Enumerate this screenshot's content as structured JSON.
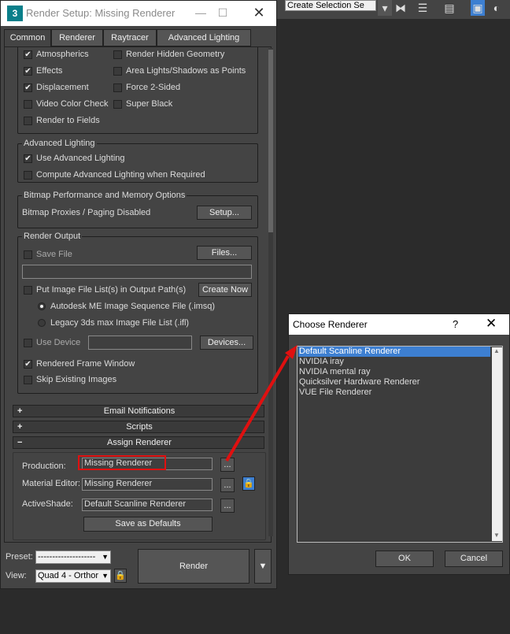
{
  "toolbar": {
    "selection_set_placeholder": "Create Selection Se"
  },
  "render_setup": {
    "title": "Render Setup: Missing Renderer",
    "tabs": [
      {
        "label": "Common",
        "active": true
      },
      {
        "label": "Renderer"
      },
      {
        "label": "Raytracer"
      },
      {
        "label": "Advanced Lighting"
      }
    ],
    "options": {
      "left": [
        {
          "label": "Atmospherics",
          "checked": true
        },
        {
          "label": "Effects",
          "checked": true
        },
        {
          "label": "Displacement",
          "checked": true
        },
        {
          "label": "Video Color Check",
          "checked": false
        },
        {
          "label": "Render to Fields",
          "checked": false
        }
      ],
      "right": [
        {
          "label": "Render Hidden Geometry",
          "checked": false
        },
        {
          "label": "Area Lights/Shadows as Points",
          "checked": false
        },
        {
          "label": "Force 2-Sided",
          "checked": false
        },
        {
          "label": "Super Black",
          "checked": false
        }
      ]
    },
    "advanced_lighting": {
      "title": "Advanced Lighting",
      "use_label": "Use Advanced Lighting",
      "compute_label": "Compute Advanced Lighting when Required"
    },
    "bitmap": {
      "title": "Bitmap Performance and Memory Options",
      "status": "Bitmap Proxies / Paging Disabled",
      "setup_button": "Setup..."
    },
    "render_output": {
      "title": "Render Output",
      "save_file_label": "Save File",
      "files_button": "Files...",
      "file_path": "",
      "put_image_label": "Put Image File List(s) in Output Path(s)",
      "create_now_button": "Create Now",
      "radio_imsq": "Autodesk ME Image Sequence File (.imsq)",
      "radio_ifl": "Legacy 3ds max Image File List (.ifl)",
      "use_device_label": "Use Device",
      "device_value": "",
      "devices_button": "Devices...",
      "frame_window_label": "Rendered Frame Window",
      "skip_existing_label": "Skip Existing Images"
    },
    "rollouts": {
      "email": "Email Notifications",
      "scripts": "Scripts",
      "assign": "Assign Renderer"
    },
    "assign": {
      "production_label": "Production:",
      "production_value": "Missing Renderer",
      "material_label": "Material Editor:",
      "material_value": "Missing Renderer",
      "activeshade_label": "ActiveShade:",
      "activeshade_value": "Default Scanline Renderer",
      "browse": "...",
      "save_defaults": "Save as Defaults"
    },
    "bottom": {
      "preset_label": "Preset:",
      "preset_value": "--------------------",
      "view_label": "View:",
      "view_value": "Quad 4 - Orthor",
      "render_button": "Render"
    }
  },
  "choose_renderer": {
    "title": "Choose Renderer",
    "help": "?",
    "items": [
      "Default Scanline Renderer",
      "NVIDIA iray",
      "NVIDIA mental ray",
      "Quicksilver Hardware Renderer",
      "VUE File Renderer"
    ],
    "selected_index": 0,
    "ok": "OK",
    "cancel": "Cancel"
  }
}
